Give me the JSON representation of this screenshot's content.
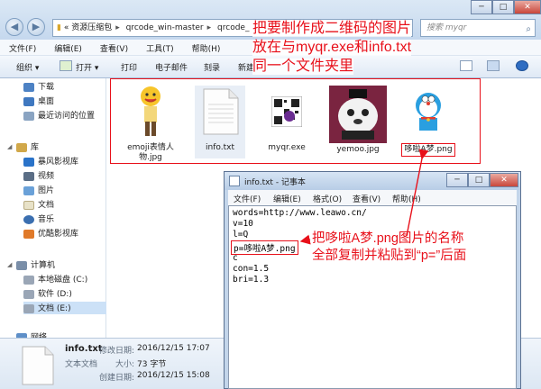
{
  "explorer": {
    "address": {
      "back_symbol": "«",
      "segments": [
        "资源压缩包",
        "qrcode_win-master",
        "qrcode_"
      ]
    },
    "search_placeholder": "搜索 myqr",
    "window_controls": [
      "─",
      "□",
      "✕"
    ],
    "menu": [
      "文件(F)",
      "编辑(E)",
      "查看(V)",
      "工具(T)",
      "帮助(H)"
    ],
    "toolbar": [
      "组织 ▾",
      "打开 ▾",
      "打印",
      "电子邮件",
      "刻录",
      "新建"
    ],
    "sidebar": {
      "favorites": [
        "下载",
        "桌面",
        "最近访问的位置"
      ],
      "library_header": "库",
      "libraries": [
        "暴风影视库",
        "视频",
        "图片",
        "文档",
        "音乐",
        "优酷影视库"
      ],
      "computer_header": "计算机",
      "drives": [
        "本地磁盘 (C:)",
        "软件 (D:)",
        "文档 (E:)"
      ],
      "network": "网络"
    },
    "files": [
      {
        "name": "emoji表情人物.jpg",
        "icon": "emoji-image"
      },
      {
        "name": "info.txt",
        "icon": "text-file"
      },
      {
        "name": "myqr.exe",
        "icon": "qr-exe"
      },
      {
        "name": "yemoo.jpg",
        "icon": "yemoo-image"
      },
      {
        "name": "哆啦A梦.png",
        "icon": "doraemon-image"
      }
    ],
    "details": {
      "filename": "info.txt",
      "type": "文本文档",
      "modified_label": "修改日期:",
      "modified": "2016/12/15 17:07",
      "size_label": "大小:",
      "size": "73 字节",
      "created_label": "创建日期:",
      "created": "2016/12/15 15:08"
    }
  },
  "notepad": {
    "title": "info.txt - 记事本",
    "menu": [
      "文件(F)",
      "编辑(E)",
      "格式(O)",
      "查看(V)",
      "帮助(H)"
    ],
    "lines": [
      "words=http://www.leawo.cn/",
      "v=10",
      "l=Q",
      "p=哆啦A梦.png",
      "c",
      "con=1.5",
      "bri=1.3"
    ]
  },
  "annotations": {
    "top": [
      "把要制作成二维码的图片",
      "放在与myqr.exe和info.txt",
      "同一个文件夹里"
    ],
    "bottom": [
      "把哆啦A梦.png图片的名称",
      "全部复制并粘贴到“p=”后面"
    ]
  },
  "colors": {
    "annotation": "#e8101a",
    "accent": "#3a6ea5"
  }
}
